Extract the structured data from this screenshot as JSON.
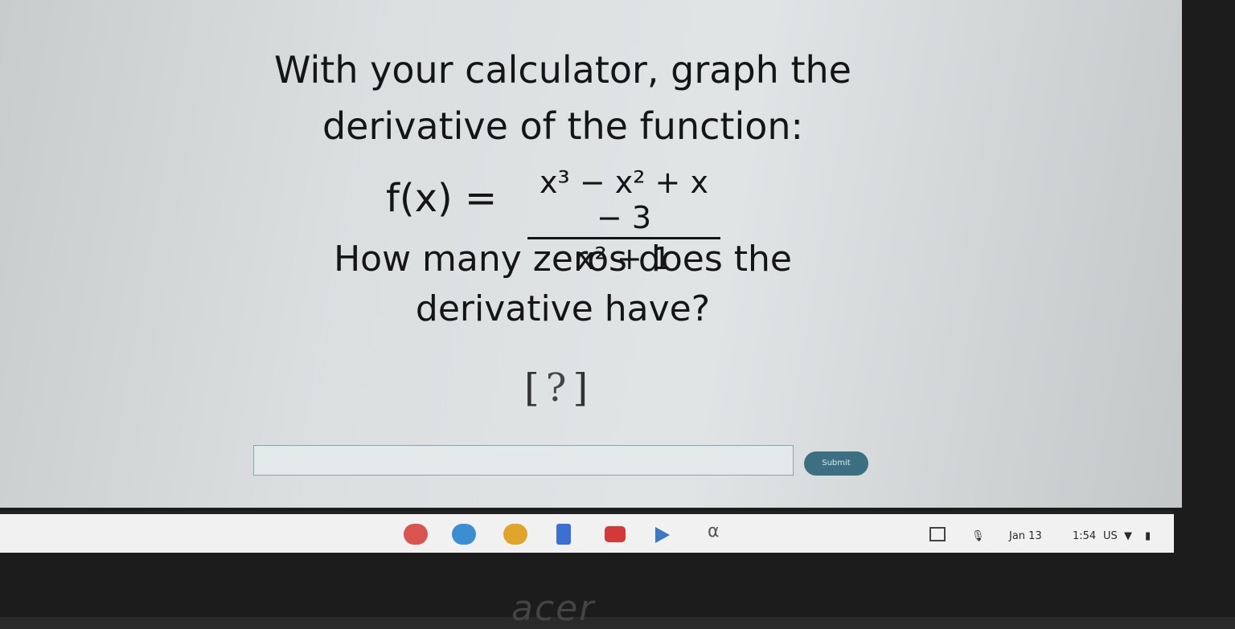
{
  "question": {
    "line1": "With your calculator, graph the",
    "line2": "derivative of the function:",
    "line3": "How many zeros does the",
    "line4": "derivative have?"
  },
  "equation": {
    "lhs": "f(x) =",
    "numerator_html": "x³ − x² + x − 3",
    "denominator_html": "x² + 1"
  },
  "answer": {
    "open": "[",
    "placeholder": "?",
    "close": "]"
  },
  "submit": {
    "label": "Submit"
  },
  "shelf": {
    "date": "Jan 13",
    "time": "1:54",
    "locale": "US"
  },
  "bezel": {
    "logo": "acer"
  },
  "colors": {
    "submit_bg": "#3c6f82",
    "input_border": "#8aa3ad"
  }
}
